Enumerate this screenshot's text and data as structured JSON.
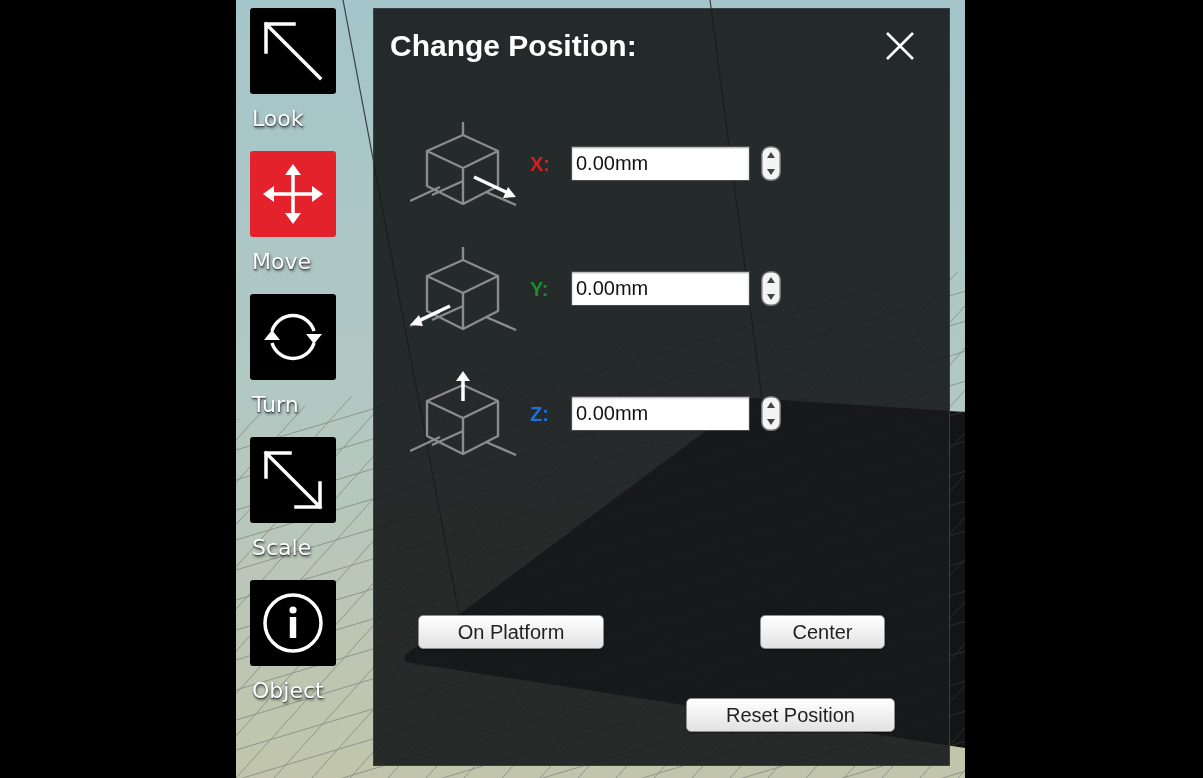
{
  "tools": [
    {
      "label": "Look",
      "selected": false
    },
    {
      "label": "Move",
      "selected": true
    },
    {
      "label": "Turn",
      "selected": false
    },
    {
      "label": "Scale",
      "selected": false
    },
    {
      "label": "Object",
      "selected": false
    }
  ],
  "panel": {
    "title": "Change Position:",
    "axes": [
      {
        "label": "X:",
        "color": "#d0211f",
        "value": "0.00mm"
      },
      {
        "label": "Y:",
        "color": "#1e8c2b",
        "value": "0.00mm"
      },
      {
        "label": "Z:",
        "color": "#1e6fdc",
        "value": "0.00mm"
      }
    ],
    "buttons": [
      "On Platform",
      "Center",
      "Reset Position"
    ]
  }
}
